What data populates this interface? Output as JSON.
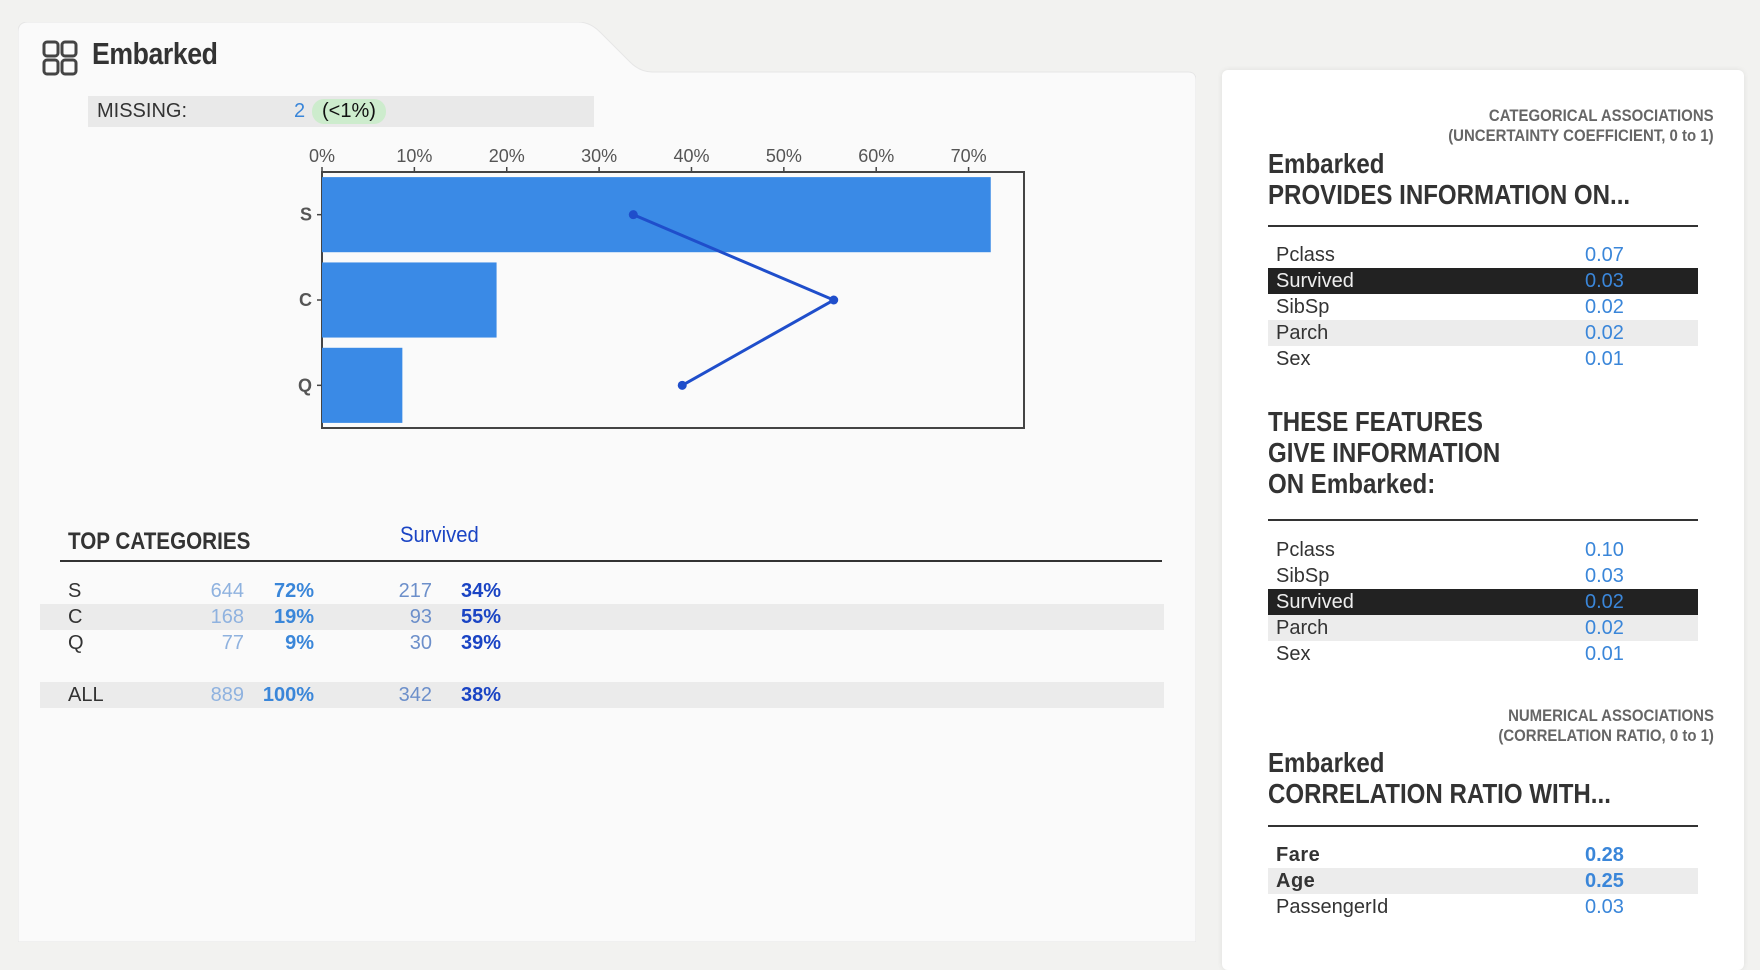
{
  "feature": {
    "name": "Embarked",
    "missing_label": "MISSING:",
    "missing_count": "2",
    "missing_pct": "(<1%)"
  },
  "chart_data": {
    "type": "bar",
    "orientation": "horizontal",
    "categories": [
      "S",
      "C",
      "Q"
    ],
    "series": [
      {
        "name": "",
        "type": "bar",
        "values": [
          72.4,
          18.9,
          8.7
        ]
      },
      {
        "name": "Survived",
        "type": "line",
        "values": [
          33.7,
          55.4,
          39.0
        ]
      }
    ],
    "xlim": [
      0,
      76
    ],
    "x_ticks": [
      0,
      10,
      20,
      30,
      40,
      50,
      60,
      70
    ],
    "x_tick_labels": [
      "0%",
      "10%",
      "20%",
      "30%",
      "40%",
      "50%",
      "60%",
      "70%"
    ],
    "colors": {
      "bar": "#3a8ae6",
      "line": "#1f4ecb"
    },
    "xlabel": "",
    "ylabel": "",
    "title": ""
  },
  "table": {
    "title": "TOP CATEGORIES",
    "target_header": "Survived",
    "rows": [
      {
        "label": "S",
        "count": "644",
        "pct": "72%",
        "target_count": "217",
        "target_pct": "34%"
      },
      {
        "label": "C",
        "count": "168",
        "pct": "19%",
        "target_count": "93",
        "target_pct": "55%"
      },
      {
        "label": "Q",
        "count": "77",
        "pct": "9%",
        "target_count": "30",
        "target_pct": "39%"
      }
    ],
    "total": {
      "label": "ALL",
      "count": "889",
      "pct": "100%",
      "target_count": "342",
      "target_pct": "38%"
    }
  },
  "assoc": {
    "cat_note_line1": "CATEGORICAL ASSOCIATIONS",
    "cat_note_line2": "(UNCERTAINTY COEFFICIENT, 0 to 1)",
    "provides_line1": "Embarked",
    "provides_line2": "PROVIDES INFORMATION ON...",
    "provides_rows": [
      {
        "name": "Pclass",
        "value": "0.07"
      },
      {
        "name": "Survived",
        "value": "0.03"
      },
      {
        "name": "SibSp",
        "value": "0.02"
      },
      {
        "name": "Parch",
        "value": "0.02"
      },
      {
        "name": "Sex",
        "value": "0.01"
      }
    ],
    "gives_line1": "THESE FEATURES",
    "gives_line2": "GIVE INFORMATION",
    "gives_line3": "ON Embarked:",
    "gives_rows": [
      {
        "name": "Pclass",
        "value": "0.10"
      },
      {
        "name": "SibSp",
        "value": "0.03"
      },
      {
        "name": "Survived",
        "value": "0.02"
      },
      {
        "name": "Parch",
        "value": "0.02"
      },
      {
        "name": "Sex",
        "value": "0.01"
      }
    ],
    "num_note_line1": "NUMERICAL ASSOCIATIONS",
    "num_note_line2": "(CORRELATION RATIO, 0 to 1)",
    "corr_line1": "Embarked",
    "corr_line2": "CORRELATION RATIO WITH...",
    "corr_rows": [
      {
        "name": "Fare",
        "value": "0.28"
      },
      {
        "name": "Age",
        "value": "0.25"
      },
      {
        "name": "PassengerId",
        "value": "0.03"
      }
    ]
  }
}
